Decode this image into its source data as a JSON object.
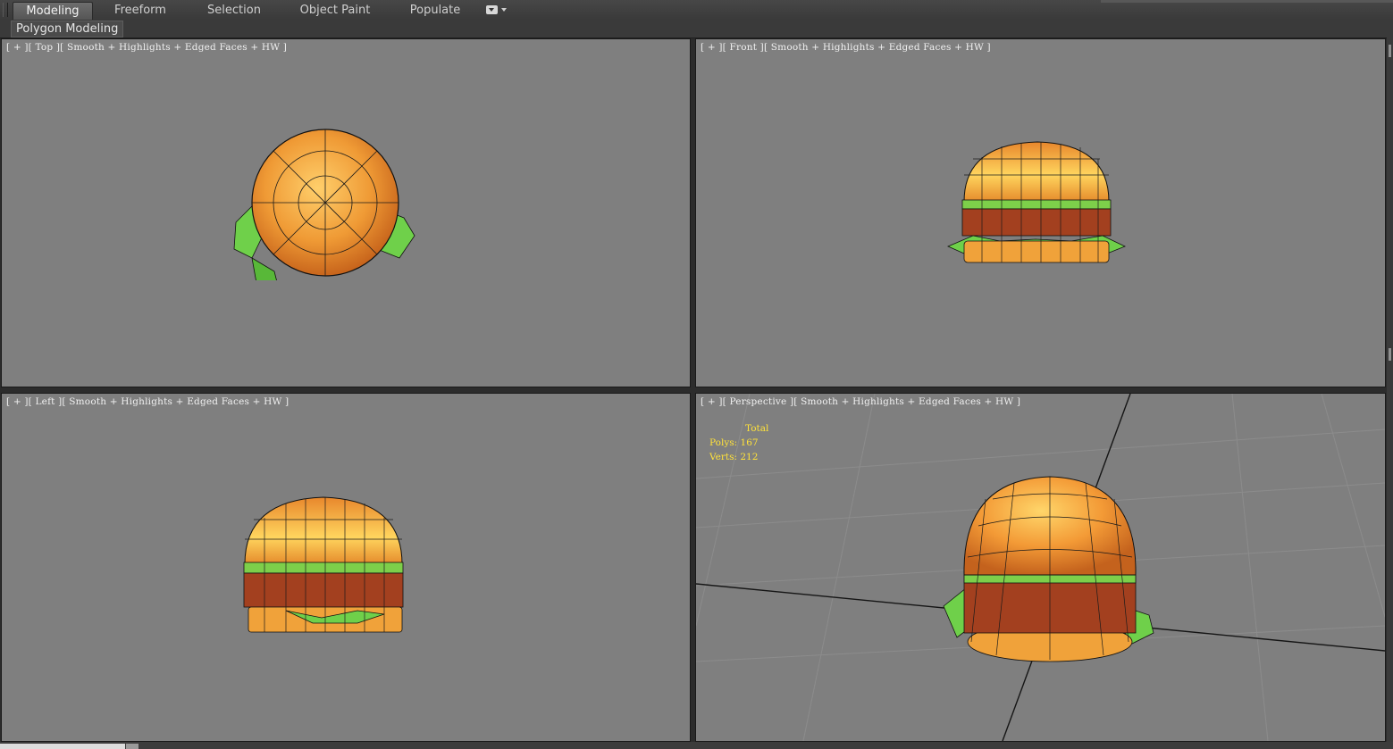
{
  "ribbon": {
    "tabs": [
      {
        "label": "Modeling",
        "active": true
      },
      {
        "label": "Freeform",
        "active": false
      },
      {
        "label": "Selection",
        "active": false
      },
      {
        "label": "Object Paint",
        "active": false
      },
      {
        "label": "Populate",
        "active": false
      }
    ],
    "panel_label": "Polygon Modeling"
  },
  "viewports": {
    "top": {
      "label": "[ + ][ Top ][ Smooth + Highlights + Edged Faces + HW ]"
    },
    "front": {
      "label": "[ + ][ Front ][ Smooth + Highlights + Edged Faces + HW ]"
    },
    "left": {
      "label": "[ + ][ Left ][ Smooth + Highlights + Edged Faces + HW ]"
    },
    "perspective": {
      "label": "[ + ][ Perspective ][ Smooth + Highlights + Edged Faces + HW ]",
      "stats": {
        "header": "Total",
        "polys_label": "Polys:",
        "polys": "167",
        "verts_label": "Verts:",
        "verts": "212"
      }
    }
  },
  "colors": {
    "viewport_bg": "#7f7f7f",
    "bun": "#e38a2a",
    "bun_highlight": "#ffd36a",
    "patty": "#9a3a1e",
    "lettuce": "#5fbf3a",
    "wire": "#111111",
    "stats_text": "#ffe23a"
  }
}
